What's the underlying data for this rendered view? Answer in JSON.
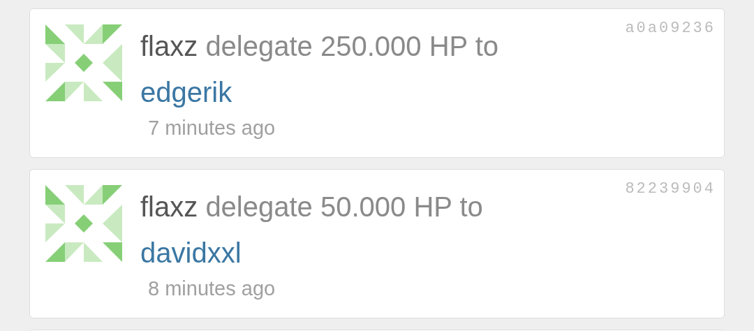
{
  "items": [
    {
      "user": "flaxz",
      "action": "delegate 250.000 HP to",
      "target": "edgerik",
      "time": "7 minutes ago",
      "hash": "a0a09236"
    },
    {
      "user": "flaxz",
      "action": "delegate 50.000 HP to",
      "target": "davidxxl",
      "time": "8 minutes ago",
      "hash": "82239904"
    }
  ]
}
